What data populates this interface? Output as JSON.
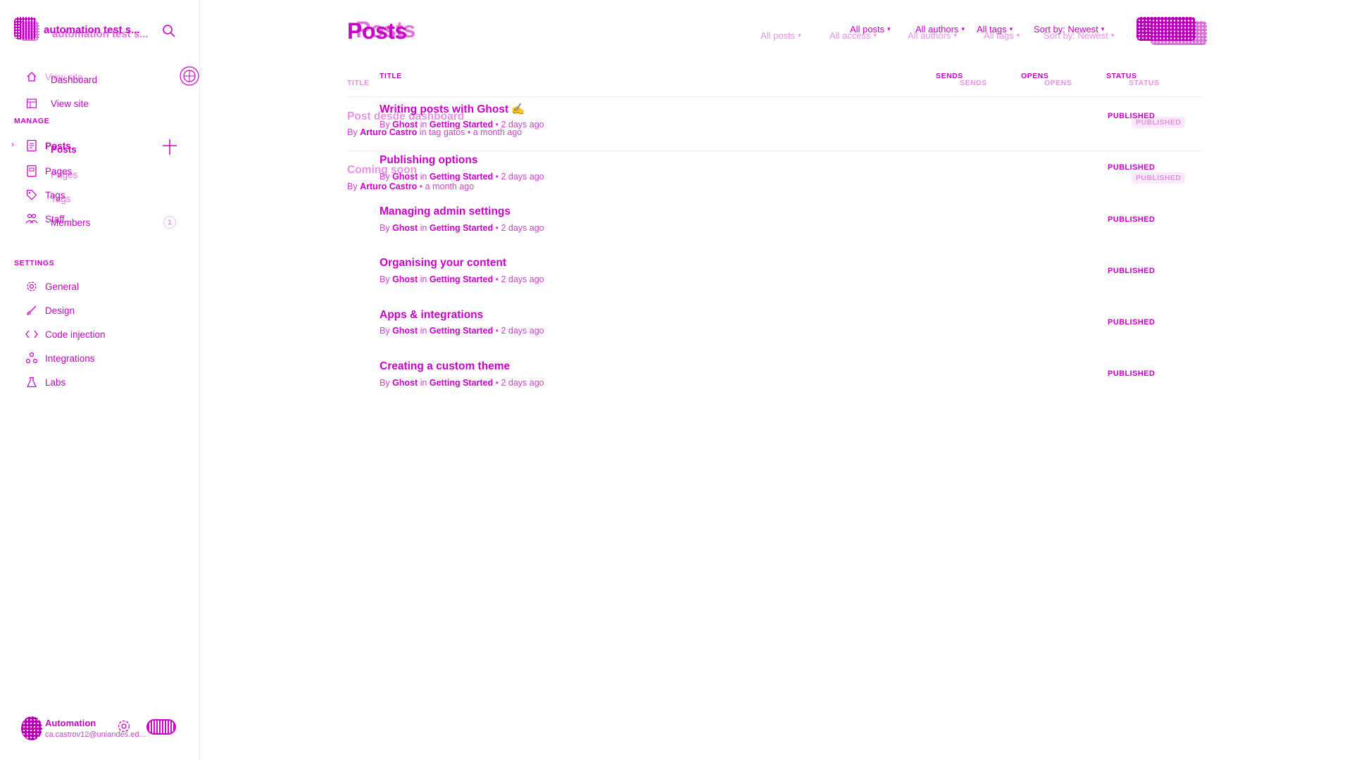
{
  "sidebar": {
    "site_title": "automation test s...",
    "site_title_ghost": "automation test s...",
    "primary": [
      {
        "label": "View site",
        "icon": "home-icon"
      },
      {
        "label": "Dashboard",
        "icon": "home-icon"
      },
      {
        "label": "View site",
        "icon": "window-icon"
      }
    ],
    "manage_label": "MANAGE",
    "manage_items": [
      {
        "label": "Posts",
        "icon": "posts-icon"
      },
      {
        "label": "Posts",
        "icon": "posts-icon"
      },
      {
        "label": "Pages",
        "icon": "pages-icon"
      },
      {
        "label": "Pages",
        "icon": "pages-icon"
      },
      {
        "label": "Tags",
        "icon": "tag-icon"
      },
      {
        "label": "Tags",
        "icon": "tag-icon"
      },
      {
        "label": "Staff",
        "icon": "staff-icon"
      },
      {
        "label": "Members",
        "icon": "members-icon"
      }
    ],
    "members_count": "1",
    "settings_label": "SETTINGS",
    "settings_items": [
      {
        "label": "General",
        "icon": "gear-icon"
      },
      {
        "label": "Design",
        "icon": "brush-icon"
      },
      {
        "label": "Code injection",
        "icon": "code-icon"
      },
      {
        "label": "Integrations",
        "icon": "integrations-icon"
      },
      {
        "label": "Labs",
        "icon": "flask-icon"
      }
    ],
    "user": {
      "name": "Automation",
      "email": "ca.castrov12@uniandes.ed..."
    }
  },
  "header": {
    "title": "Posts",
    "title_ghost": "Posts",
    "filters_front": [
      "All posts",
      "All authors",
      "All tags",
      "Sort by: Newest"
    ],
    "filters_back": [
      "All posts",
      "All access",
      "All authors",
      "All tags",
      "Sort by: Newest"
    ]
  },
  "table": {
    "columns_back": [
      "TITLE",
      "SENDS",
      "OPENS",
      "STATUS"
    ],
    "columns_front": [
      "TITLE",
      "SENDS",
      "OPENS",
      "STATUS"
    ],
    "ghost_rows": [
      {
        "title": "Post desde dashboard",
        "meta_by": "By ",
        "author": "Arturo Castro",
        "meta_rest": " in tag gatos • a month ago",
        "status": "PUBLISHED"
      },
      {
        "title": "Coming soon",
        "meta_by": "By ",
        "author": "Arturo Castro",
        "meta_rest": " • a month ago",
        "status": "PUBLISHED"
      }
    ],
    "rows": [
      {
        "title": "Writing posts with Ghost ✍️",
        "by": "By ",
        "author": "Ghost",
        "in": " in ",
        "tag": "Getting Started",
        "time": " • 2 days ago",
        "status": "PUBLISHED"
      },
      {
        "title": "Publishing options",
        "by": "By ",
        "author": "Ghost",
        "in": " in ",
        "tag": "Getting Started",
        "time": " • 2 days ago",
        "status": "PUBLISHED"
      },
      {
        "title": "Managing admin settings",
        "by": "By ",
        "author": "Ghost",
        "in": " in ",
        "tag": "Getting Started",
        "time": " • 2 days ago",
        "status": "PUBLISHED"
      },
      {
        "title": "Organising your content",
        "by": "By ",
        "author": "Ghost",
        "in": " in ",
        "tag": "Getting Started",
        "time": " • 2 days ago",
        "status": "PUBLISHED"
      },
      {
        "title": "Apps & integrations",
        "by": "By ",
        "author": "Ghost",
        "in": " in ",
        "tag": "Getting Started",
        "time": " • 2 days ago",
        "status": "PUBLISHED"
      },
      {
        "title": "Creating a custom theme",
        "by": "By ",
        "author": "Ghost",
        "in": " in ",
        "tag": "Getting Started",
        "time": " • 2 days ago",
        "status": "PUBLISHED"
      }
    ]
  },
  "colors": {
    "accent": "#cc00cc",
    "light": "#e890e8"
  }
}
